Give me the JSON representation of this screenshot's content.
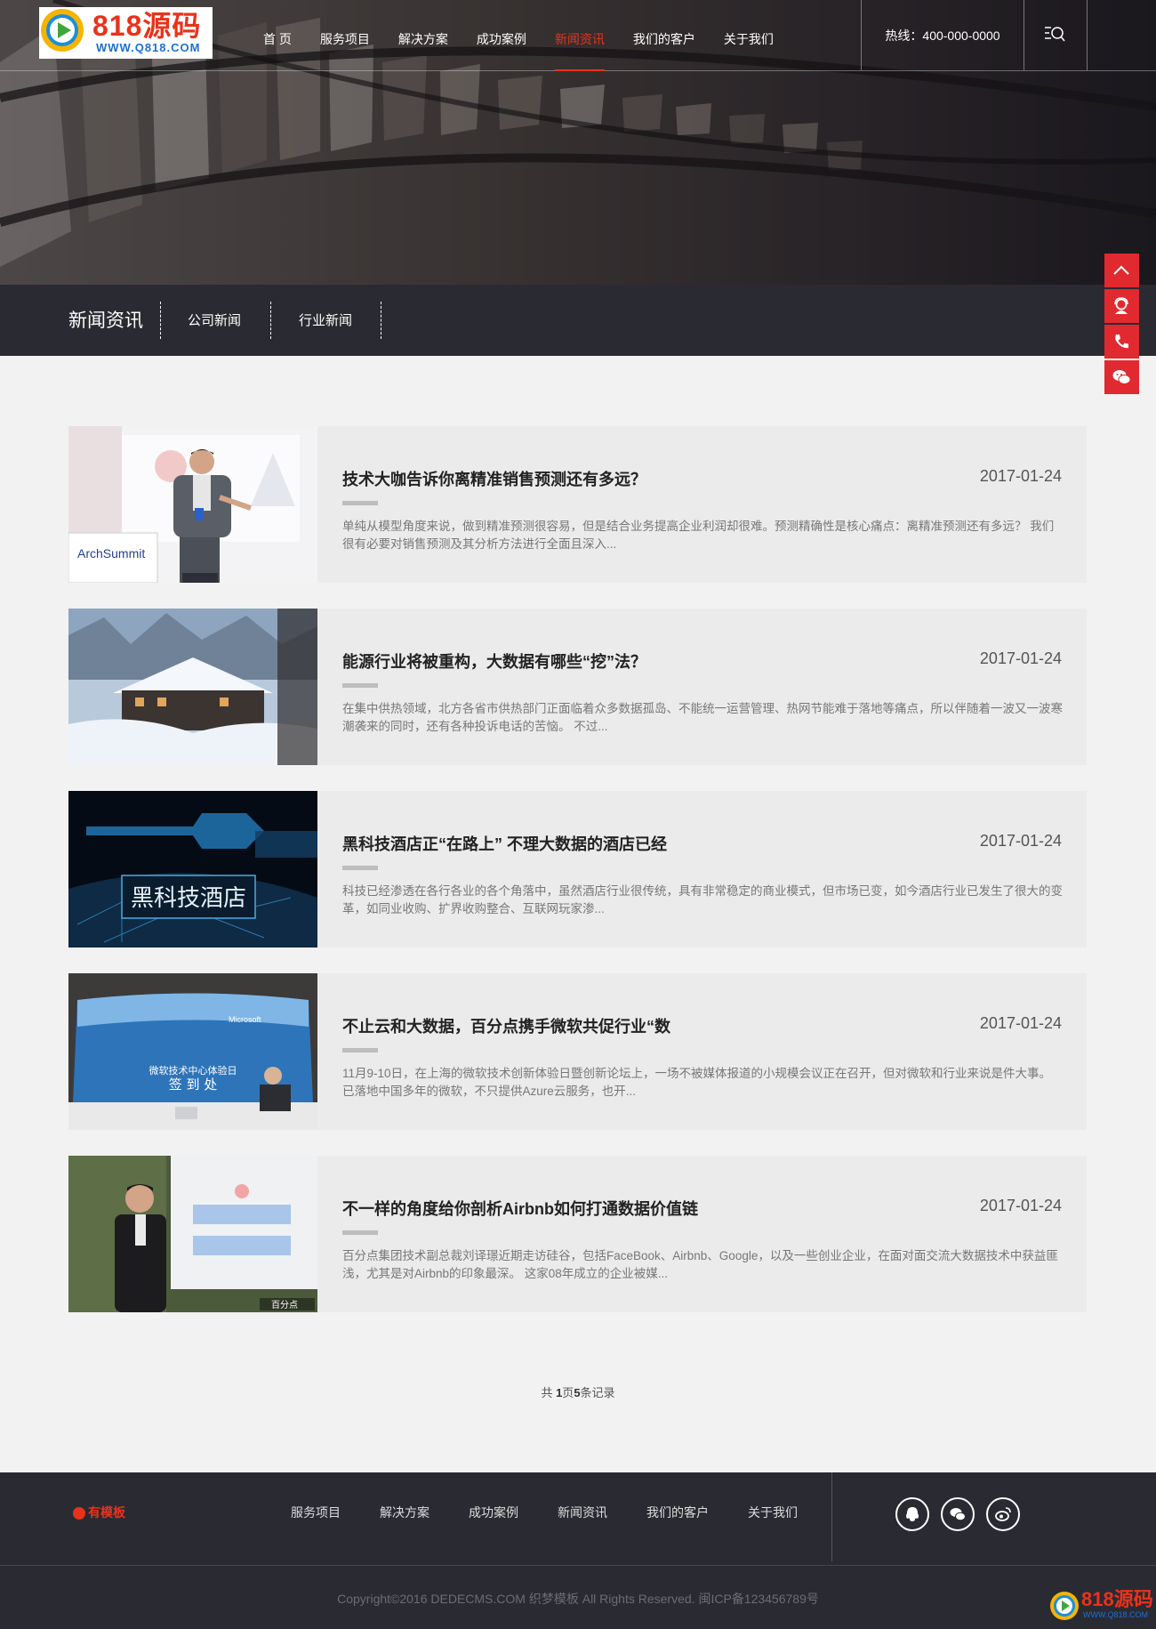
{
  "logo": {
    "name": "818源码",
    "url": "WWW.Q818.COM"
  },
  "nav": {
    "items": [
      "首 页",
      "服务项目",
      "解决方案",
      "成功案例",
      "新闻资讯",
      "我们的客户",
      "关于我们"
    ],
    "active_index": 4
  },
  "hotline": "热线：400-000-0000",
  "subnav": {
    "title": "新闻资讯",
    "links": [
      "公司新闻",
      "行业新闻"
    ]
  },
  "news": [
    {
      "title": "技术大咖告诉你离精准销售预测还有多远？",
      "date": "2017-01-24",
      "desc": "单纯从模型角度来说，做到精准预测很容易，但是结合业务提高企业利润却很难。预测精确性是核心痛点：离精准预测还有多远？ 我们很有必要对销售预测及其分析方法进行全面且深入...",
      "image_caption": "ArchSummit"
    },
    {
      "title": "能源行业将被重构，大数据有哪些“挖”法？",
      "date": "2017-01-24",
      "desc": "在集中供热领域，北方各省市供热部门正面临着众多数据孤岛、不能统一运营管理、热网节能难于落地等痛点，所以伴随着一波又一波寒潮袭来的同时，还有各种投诉电话的苦恼。 不过..."
    },
    {
      "title": "黑科技酒店正“在路上” 不理大数据的酒店已经",
      "date": "2017-01-24",
      "desc": "科技已经渗透在各行各业的各个角落中，虽然酒店行业很传统，具有非常稳定的商业模式，但市场已变，如今酒店行业已发生了很大的变革，如同业收购、扩界收购整合、互联网玩家渗...",
      "image_caption": "黑科技酒店"
    },
    {
      "title": "不止云和大数据，百分点携手微软共促行业“数",
      "date": "2017-01-24",
      "desc": "11月9-10日，在上海的微软技术创新体验日暨创新论坛上，一场不被媒体报道的小规模会议正在召开，但对微软和行业来说是件大事。已落地中国多年的微软，不只提供Azure云服务，也开...",
      "image_caption": "微软技术中心体验日",
      "image_caption2": "签 到 处",
      "image_brand": "Microsoft"
    },
    {
      "title": "不一样的角度给你剖析Airbnb如何打通数据价值链",
      "date": "2017-01-24",
      "desc": "百分点集团技术副总裁刘译璟近期走访硅谷，包括FaceBook、Airbnb、Google，以及一些创业企业，在面对面交流大数据技术中获益匪浅，尤其是对Airbnb的印象最深。 这家08年成立的企业被媒...",
      "image_caption": "百分点"
    }
  ],
  "pager": {
    "prefix": "共 ",
    "pages": "1",
    "mid": "页",
    "count": "5",
    "suffix": "条记录"
  },
  "footer": {
    "logo": "有模板",
    "nav": [
      "服务项目",
      "解决方案",
      "成功案例",
      "新闻资讯",
      "我们的客户",
      "关于我们"
    ],
    "social": [
      "qq-icon",
      "wechat-icon",
      "weibo-icon"
    ],
    "copyright": "Copyright©2016 DEDECMS.COM 织梦模板 All Rights Reserved.  闽ICP备123456789号"
  },
  "watermark": {
    "name": "818源码",
    "url": "WWW.Q818.COM"
  },
  "colors": {
    "accent": "#e8331b",
    "dark": "#2a2a33",
    "float_red": "#e02a2f"
  }
}
